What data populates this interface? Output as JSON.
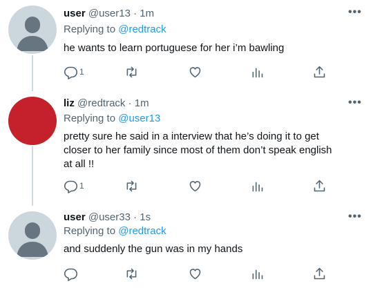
{
  "tweets": [
    {
      "name": "user",
      "handle": "@user13",
      "time": "· 1m",
      "reply_prefix": "Replying to",
      "reply_to": "@redtrack",
      "text": "he wants to learn portuguese for her i’m bawling",
      "reply_count": "1",
      "avatar": "default-avatar"
    },
    {
      "name": "liz",
      "handle": "@redtrack",
      "time": "· 1m",
      "reply_prefix": "Replying to",
      "reply_to": "@user13",
      "text_lines": [
        "pretty sure he said in a interview that he’s doing it to get",
        "closer to her family since most of them don’t speak english",
        "at all !!"
      ],
      "reply_count": "1",
      "avatar_color": "#c4212b"
    },
    {
      "name": "user",
      "handle": "@user33",
      "time": "· 1s",
      "reply_prefix": "Replying to",
      "reply_to": "@redtrack",
      "text": "and suddenly the gun was in my hands",
      "reply_count": "",
      "avatar": "default-avatar"
    }
  ],
  "icons": [
    "reply-icon",
    "retweet-icon",
    "like-icon",
    "analytics-icon",
    "share-icon",
    "more-icon"
  ],
  "colors": {
    "link": "#1d9bf0",
    "secondary_text": "#536471",
    "avatar_gray": "#ccd6dd",
    "avatar_red": "#c4212b"
  }
}
